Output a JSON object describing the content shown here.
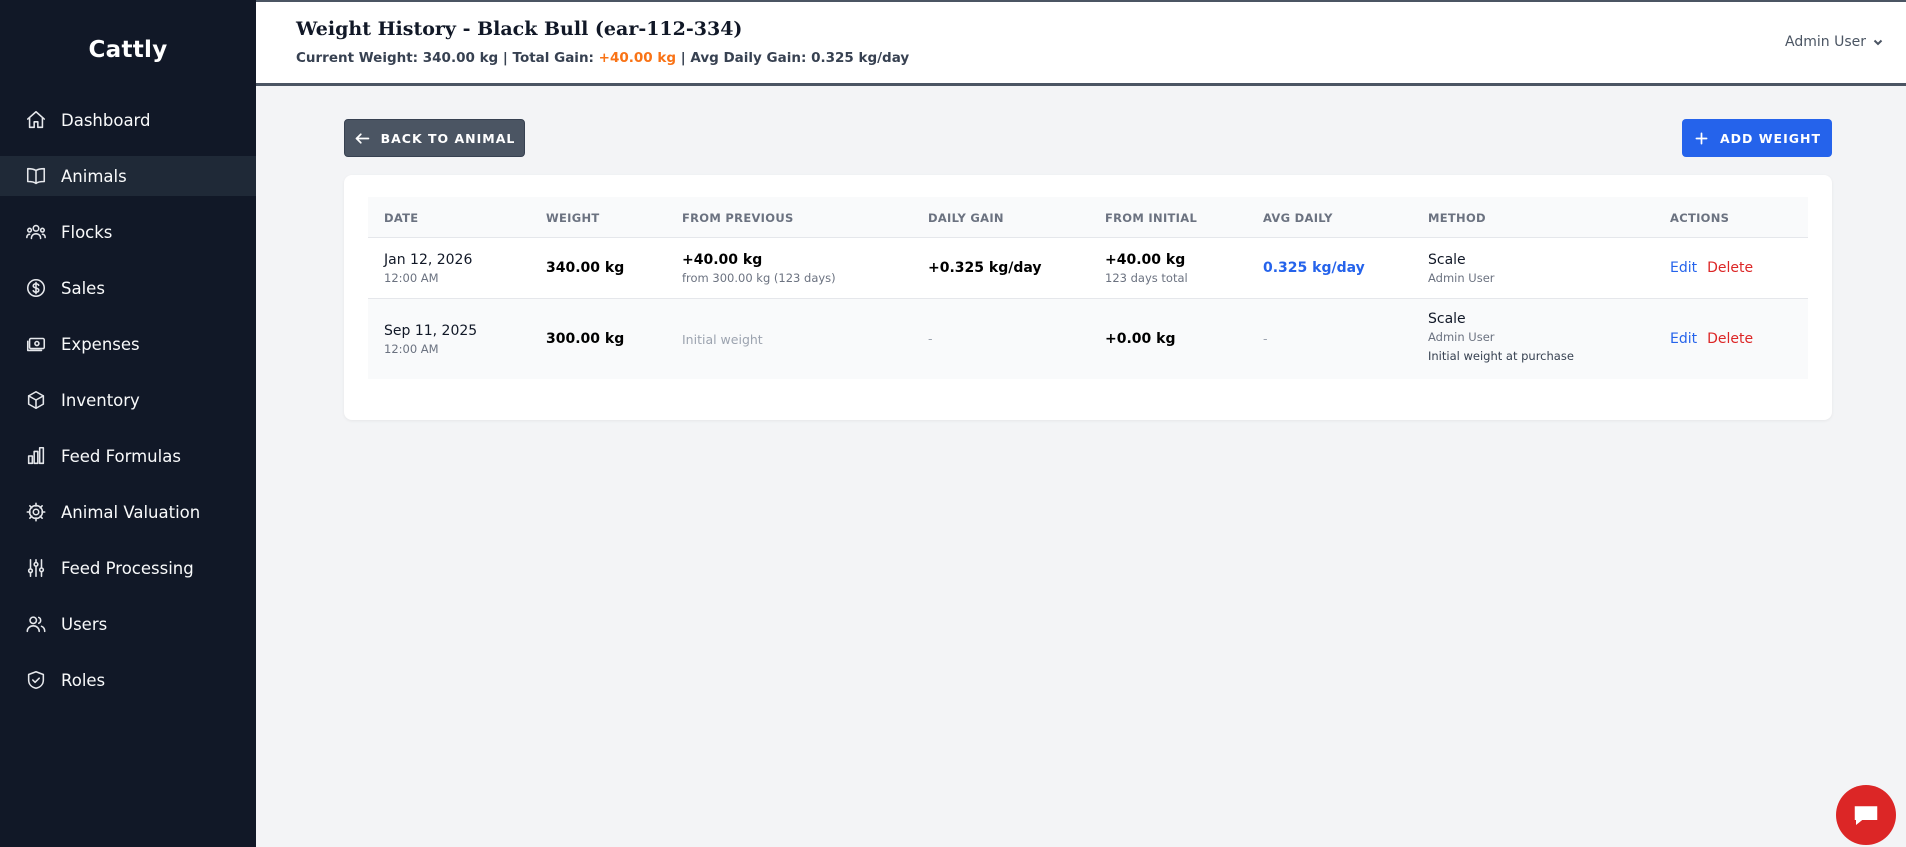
{
  "app": {
    "brand": "Cattly"
  },
  "sidebar": {
    "items": [
      {
        "label": "Dashboard",
        "icon": "home-icon"
      },
      {
        "label": "Animals",
        "icon": "book-icon",
        "active": true
      },
      {
        "label": "Flocks",
        "icon": "users-group-icon"
      },
      {
        "label": "Sales",
        "icon": "dollar-circle-icon"
      },
      {
        "label": "Expenses",
        "icon": "cash-icon"
      },
      {
        "label": "Inventory",
        "icon": "cube-icon"
      },
      {
        "label": "Feed Formulas",
        "icon": "bar-chart-icon"
      },
      {
        "label": "Animal Valuation",
        "icon": "gear-icon"
      },
      {
        "label": "Feed Processing",
        "icon": "sliders-icon"
      },
      {
        "label": "Users",
        "icon": "users-icon"
      },
      {
        "label": "Roles",
        "icon": "shield-check-icon"
      }
    ]
  },
  "header": {
    "title": "Weight History - Black Bull (ear-112-334)",
    "stats_prefix": "Current Weight: 340.00 kg | Total Gain: ",
    "stats_gain": "+40.00 kg",
    "stats_suffix": " | Avg Daily Gain: 0.325 kg/day",
    "user_name": "Admin User"
  },
  "toolbar": {
    "back_label": "BACK TO ANIMAL",
    "add_label": "ADD WEIGHT"
  },
  "colors": {
    "sidebar_bg": "#111827",
    "accent_blue": "#2563eb",
    "gain_orange": "#f97316",
    "delete_red": "#dc2626"
  },
  "table": {
    "headers": {
      "date": "DATE",
      "weight": "WEIGHT",
      "from_previous": "FROM PREVIOUS",
      "daily_gain": "DAILY GAIN",
      "from_initial": "FROM INITIAL",
      "avg_daily": "AVG DAILY",
      "method": "METHOD",
      "actions": "ACTIONS"
    },
    "rows": [
      {
        "date": "Jan 12, 2026",
        "time": "12:00 AM",
        "weight": "340.00 kg",
        "from_previous": "+40.00 kg",
        "from_previous_sub": "from 300.00 kg (123 days)",
        "daily_gain": "+0.325 kg/day",
        "from_initial": "+40.00 kg",
        "from_initial_sub": "123 days total",
        "avg_daily": "0.325 kg/day",
        "method": "Scale",
        "method_user": "Admin User",
        "note": "",
        "edit": "Edit",
        "delete": "Delete"
      },
      {
        "date": "Sep 11, 2025",
        "time": "12:00 AM",
        "weight": "300.00 kg",
        "from_previous": "Initial weight",
        "daily_gain": "-",
        "from_initial": "+0.00 kg",
        "avg_daily": "-",
        "method": "Scale",
        "method_user": "Admin User",
        "note": "Initial weight at purchase",
        "edit": "Edit",
        "delete": "Delete"
      }
    ]
  }
}
